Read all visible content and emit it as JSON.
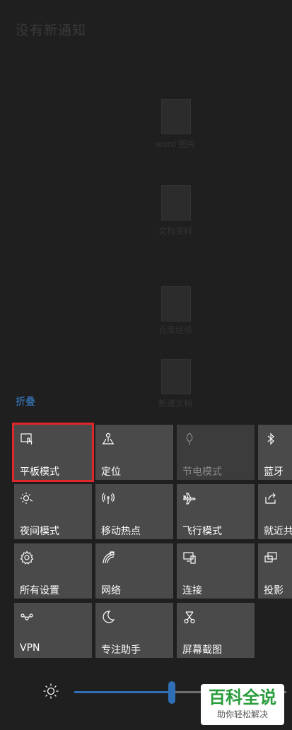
{
  "background": {
    "heading": "没有新通知",
    "ghost_items": [
      "word 图片",
      "文档资料",
      "百度经验",
      "新建文档"
    ]
  },
  "collapse_label": "折叠",
  "tiles": [
    {
      "label": "平板模式",
      "icon": "tablet-mode-icon",
      "highlighted": true
    },
    {
      "label": "定位",
      "icon": "location-icon"
    },
    {
      "label": "节电模式",
      "icon": "battery-saver-icon",
      "dimmed": true
    },
    {
      "label": "蓝牙",
      "icon": "bluetooth-icon"
    },
    {
      "label": "夜间模式",
      "icon": "night-light-icon"
    },
    {
      "label": "移动热点",
      "icon": "mobile-hotspot-icon"
    },
    {
      "label": "飞行模式",
      "icon": "airplane-icon"
    },
    {
      "label": "就近共",
      "icon": "nearby-sharing-icon"
    },
    {
      "label": "所有设置",
      "icon": "settings-gear-icon"
    },
    {
      "label": "网络",
      "icon": "network-icon"
    },
    {
      "label": "连接",
      "icon": "connect-icon"
    },
    {
      "label": "投影",
      "icon": "project-icon"
    },
    {
      "label": "VPN",
      "icon": "vpn-icon"
    },
    {
      "label": "专注助手",
      "icon": "focus-assist-moon-icon"
    },
    {
      "label": "屏幕截图",
      "icon": "screen-snip-icon"
    }
  ],
  "brightness": {
    "level_percent": 46,
    "icon": "brightness-sun-icon"
  },
  "watermark": {
    "main": "百科全说",
    "sub": "助你轻松解决"
  },
  "colors": {
    "accent": "#2f6fb6",
    "highlight": "#e0262a",
    "tile": "#4a4a4a",
    "link": "#3a86d6"
  }
}
